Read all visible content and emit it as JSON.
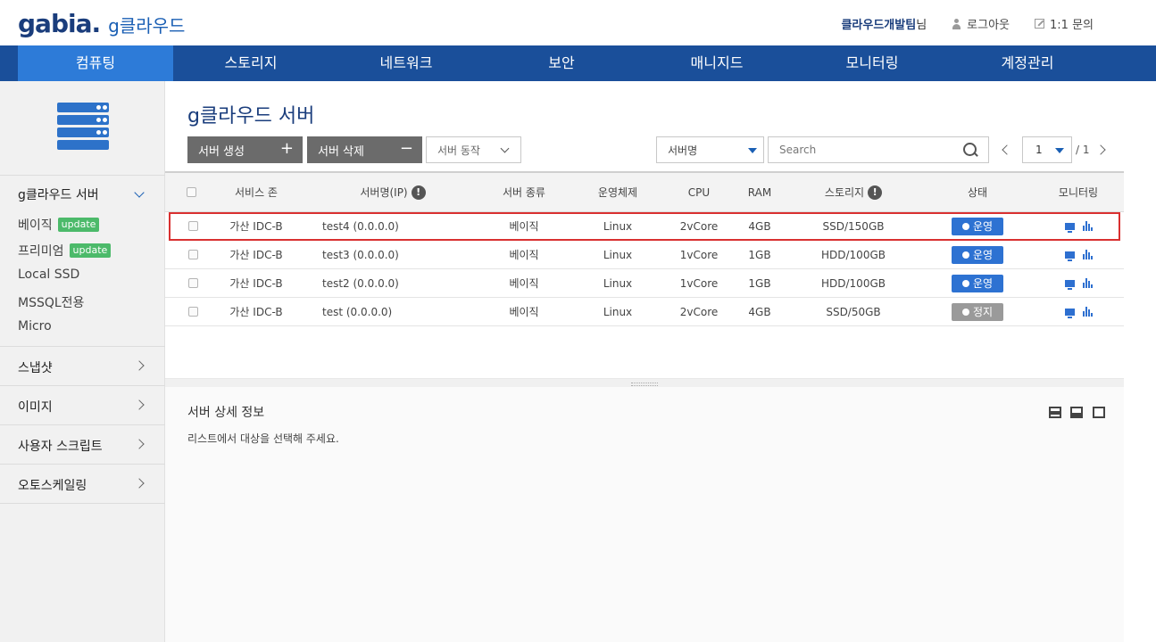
{
  "header": {
    "logo_text": "gabia",
    "logo_sub": "g클라우드",
    "user_name": "클라우드개발팀",
    "user_suffix": "님",
    "logout_label": "로그아웃",
    "inquiry_label": "1:1 문의"
  },
  "nav": {
    "items": [
      {
        "label": "컴퓨팅"
      },
      {
        "label": "스토리지"
      },
      {
        "label": "네트워크"
      },
      {
        "label": "보안"
      },
      {
        "label": "매니지드"
      },
      {
        "label": "모니터링"
      },
      {
        "label": "계정관리"
      }
    ],
    "active_index": 0
  },
  "sidebar": {
    "section_title": "g클라우드 서버",
    "sub_items": [
      {
        "label": "베이직",
        "badge": "update"
      },
      {
        "label": "프리미엄",
        "badge": "update"
      },
      {
        "label": "Local SSD"
      },
      {
        "label": "MSSQL전용"
      },
      {
        "label": "Micro"
      }
    ],
    "groups": [
      {
        "label": "스냅샷"
      },
      {
        "label": "이미지"
      },
      {
        "label": "사용자 스크립트"
      },
      {
        "label": "오토스케일링"
      }
    ]
  },
  "main": {
    "title": "g클라우드 서버",
    "create_button": "서버 생성",
    "delete_button": "서버 삭제",
    "action_select": "서버 동작",
    "filter_select": "서버명",
    "search_placeholder": "Search",
    "page_current": "1",
    "page_total": "/ 1"
  },
  "table": {
    "columns": {
      "zone": "서비스 존",
      "name": "서버명(IP)",
      "type": "서버 종류",
      "os": "운영체제",
      "cpu": "CPU",
      "ram": "RAM",
      "storage": "스토리지",
      "status": "상태",
      "monitoring": "모니터링"
    },
    "rows": [
      {
        "zone": "가산 IDC-B",
        "name": "test4 (0.0.0.0)",
        "type": "베이직",
        "os": "Linux",
        "cpu": "2vCore",
        "ram": "4GB",
        "storage": "SSD/150GB",
        "status": "운영",
        "running": true
      },
      {
        "zone": "가산 IDC-B",
        "name": "test3 (0.0.0.0)",
        "type": "베이직",
        "os": "Linux",
        "cpu": "1vCore",
        "ram": "1GB",
        "storage": "HDD/100GB",
        "status": "운영",
        "running": true
      },
      {
        "zone": "가산 IDC-B",
        "name": "test2 (0.0.0.0)",
        "type": "베이직",
        "os": "Linux",
        "cpu": "1vCore",
        "ram": "1GB",
        "storage": "HDD/100GB",
        "status": "운영",
        "running": true
      },
      {
        "zone": "가산 IDC-B",
        "name": "test (0.0.0.0)",
        "type": "베이직",
        "os": "Linux",
        "cpu": "2vCore",
        "ram": "4GB",
        "storage": "SSD/50GB",
        "status": "정지",
        "running": false
      }
    ],
    "selected_row": 0
  },
  "detail": {
    "title": "서버 상세 정보",
    "message": "리스트에서 대상을 선택해 주세요."
  },
  "colors": {
    "nav_bg": "#1a4f9a",
    "nav_active": "#2d7bd8",
    "status_running": "#2d72d2",
    "status_stopped": "#9a9a9a",
    "badge_update": "#4cba6a",
    "selection_outline": "#d93030"
  },
  "icons": {
    "server": "server-stack-icon",
    "search": "search-icon",
    "info": "info-icon",
    "monitor": "monitor-icon",
    "chart": "bar-chart-icon",
    "person": "person-icon",
    "pen": "edit-icon"
  }
}
